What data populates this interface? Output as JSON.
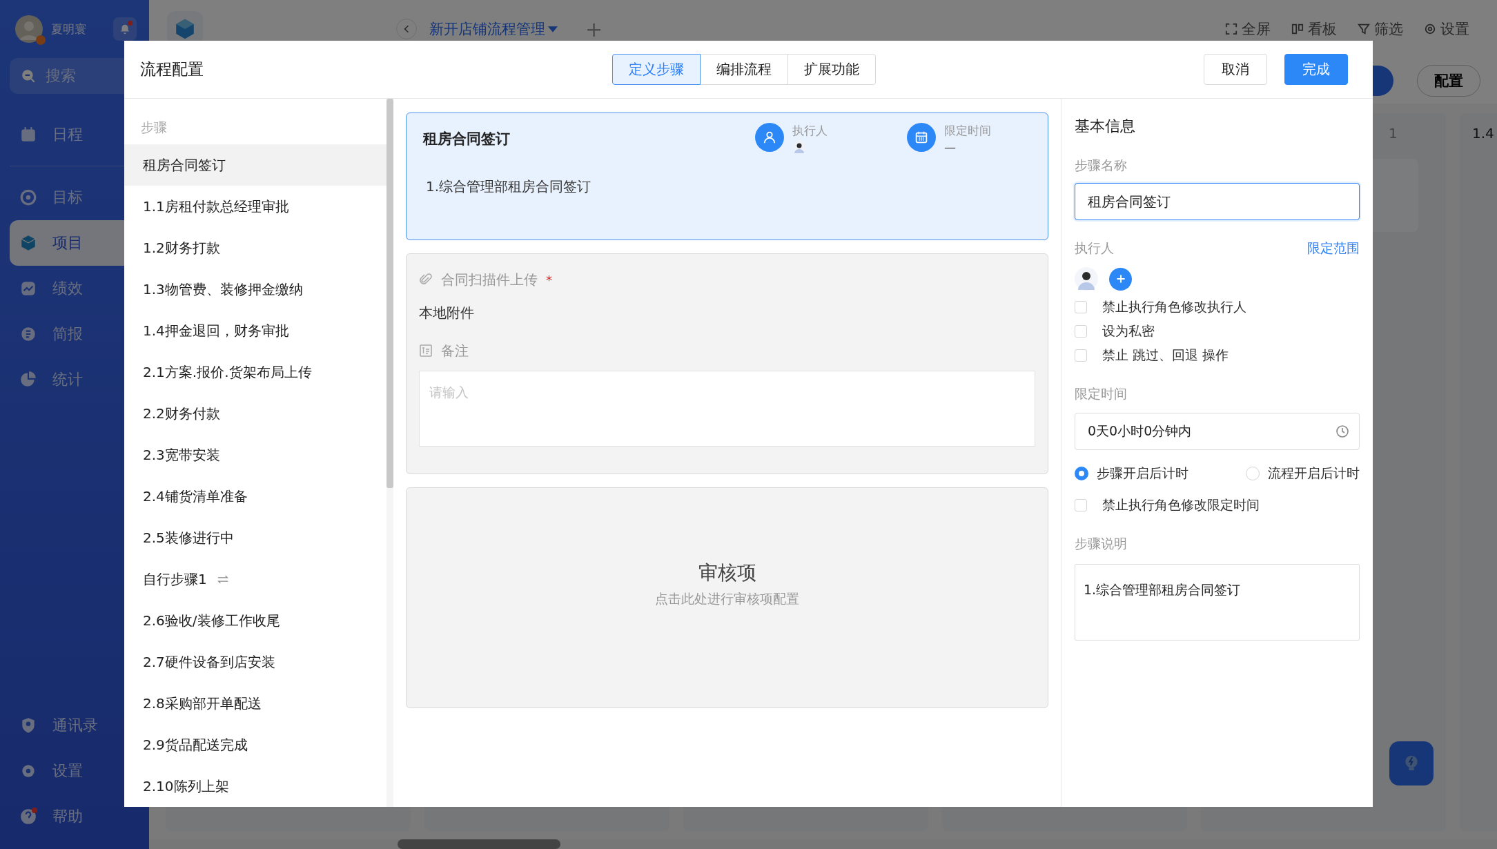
{
  "sidebar": {
    "user": {
      "name": "夏明寰",
      "admin": true
    },
    "bell": {
      "unread": true
    },
    "search": {
      "placeholder": "搜索"
    },
    "items": [
      {
        "label": "日程",
        "selected": false
      },
      {
        "label": "目标",
        "selected": false
      },
      {
        "label": "项目",
        "selected": true
      },
      {
        "label": "绩效",
        "selected": false
      },
      {
        "label": "简报",
        "selected": false
      },
      {
        "label": "统计",
        "selected": false
      }
    ],
    "bottom_items": [
      {
        "label": "通讯录",
        "unread": false
      },
      {
        "label": "设置",
        "unread": false
      },
      {
        "label": "帮助",
        "unread": true
      }
    ]
  },
  "header": {
    "tabs": [
      {
        "label": "新开店铺流程管理",
        "selected": true
      }
    ],
    "add_tab": "+",
    "toolbar": [
      {
        "label": "全屏"
      },
      {
        "label": "看板"
      },
      {
        "label": "筛选"
      },
      {
        "label": "设置"
      }
    ],
    "config_button": "配置"
  },
  "board": {
    "columns": [
      {
        "count": "1"
      },
      {
        "title": "1.4"
      }
    ]
  },
  "modal": {
    "title": "流程配置",
    "tabs": [
      {
        "label": "定义步骤",
        "selected": true
      },
      {
        "label": "编排流程",
        "selected": false
      },
      {
        "label": "扩展功能",
        "selected": false
      }
    ],
    "cancel": "取消",
    "done": "完成",
    "steps_header": "步骤",
    "steps": [
      {
        "label": "租房合同签订",
        "kind": "standard",
        "selected": true
      },
      {
        "label": "1.1房租付款总经理审批",
        "kind": "standard",
        "selected": false
      },
      {
        "label": "1.2财务打款",
        "kind": "standard",
        "selected": false
      },
      {
        "label": "1.3物管费、装修押金缴纳",
        "kind": "standard",
        "selected": false
      },
      {
        "label": "1.4押金退回，财务审批",
        "kind": "standard",
        "selected": false
      },
      {
        "label": "2.1方案.报价.货架布局上传",
        "kind": "standard",
        "selected": false
      },
      {
        "label": "2.2财务付款",
        "kind": "standard",
        "selected": false
      },
      {
        "label": "2.3宽带安装",
        "kind": "standard",
        "selected": false
      },
      {
        "label": "2.4铺货清单准备",
        "kind": "standard",
        "selected": false
      },
      {
        "label": "2.5装修进行中",
        "kind": "standard",
        "selected": false
      },
      {
        "label": "自行步骤1",
        "kind": "custom",
        "selected": false
      },
      {
        "label": "2.6验收/装修工作收尾",
        "kind": "standard",
        "selected": false
      },
      {
        "label": "2.7硬件设备到店安装",
        "kind": "standard",
        "selected": false
      },
      {
        "label": "2.8采购部开单配送",
        "kind": "standard",
        "selected": false
      },
      {
        "label": "2.9货品配送完成",
        "kind": "standard",
        "selected": false
      },
      {
        "label": "2.10陈列上架",
        "kind": "standard",
        "selected": false
      }
    ],
    "step_card": {
      "title": "租房合同签订",
      "executor_label": "执行人",
      "time_label": "限定时间",
      "time_value": "—",
      "description": "1.综合管理部租房合同签订"
    },
    "fields": {
      "attachment_label": "合同扫描件上传",
      "required_mark": "*",
      "attachment_value": "本地附件",
      "note_label": "备注",
      "note_placeholder": "请输入"
    },
    "review": {
      "title": "审核项",
      "hint": "点击此处进行审核项配置"
    },
    "info": {
      "title": "基本信息",
      "name_label": "步骤名称",
      "name_value": "租房合同签订",
      "executor_label": "执行人",
      "scope_link": "限定范围",
      "executor_options": [
        {
          "label": "禁止执行角色修改执行人",
          "checked": false
        },
        {
          "label": "设为私密",
          "checked": false
        },
        {
          "label": "禁止 跳过、回退 操作",
          "checked": false
        }
      ],
      "time_label": "限定时间",
      "time_value": "0天0小时0分钟内",
      "timing": [
        {
          "label": "步骤开启后计时",
          "selected": true
        },
        {
          "label": "流程开启后计时",
          "selected": false
        }
      ],
      "time_option": {
        "label": "禁止执行角色修改限定时间",
        "checked": false
      },
      "desc_label": "步骤说明",
      "desc_value": "1.综合管理部租房合同签订"
    }
  }
}
